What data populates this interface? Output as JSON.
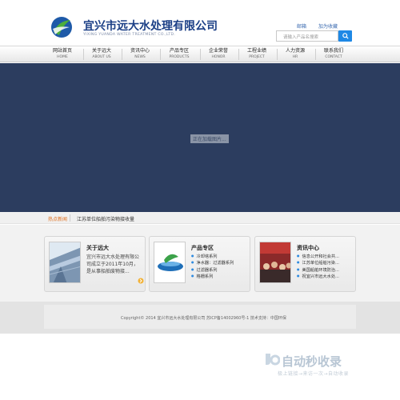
{
  "header": {
    "company_name": "宜兴市远大水处理有限公司",
    "company_name_en": "YIXING YUANDA WATER TREATMENT CO.,LTD.",
    "top_links": [
      "邮箱",
      "加为收藏"
    ],
    "search": {
      "placeholder": "请输入产品名搜索"
    }
  },
  "nav": [
    {
      "cn": "网站首页",
      "en": "HOME"
    },
    {
      "cn": "关于远大",
      "en": "ABOUT US"
    },
    {
      "cn": "资讯中心",
      "en": "NEWS"
    },
    {
      "cn": "产品专区",
      "en": "PRODUCTS"
    },
    {
      "cn": "企业荣誉",
      "en": "HONOR"
    },
    {
      "cn": "工程业绩",
      "en": "PROJECT"
    },
    {
      "cn": "人力资源",
      "en": "HR"
    },
    {
      "cn": "联系我们",
      "en": "CONTACT"
    }
  ],
  "banner": {
    "status_text": "正在加载图片..."
  },
  "ticker": {
    "label": "热点新闻",
    "headline": "江苏单位船舶污染物接收量"
  },
  "cards": {
    "about": {
      "title": "关于远大",
      "body": "宜兴市远大水处理有限公司成立于2011年10月，是从事船舶废物接..."
    },
    "products": {
      "title": "产品专区",
      "items": [
        "冷却塔系列",
        "净水器：过滤器系列",
        "过滤器系列",
        "格栅系列"
      ]
    },
    "news": {
      "title": "资讯中心",
      "items": [
        "信息公开和社会共...",
        "江苏单位船舶污染...",
        "美国船舶环境防治...",
        "祝宜兴市远大水处..."
      ]
    }
  },
  "footer": {
    "copyright": "Copyright© 2014  宜兴市远大水处理有限公司  苏ICP备14002960号-1        技术支持：中国环保"
  },
  "watermark": {
    "title": "自动秒收录",
    "subtitle": "极上链接→来访一次→自动收录"
  },
  "colors": {
    "brand": "#1b3f86",
    "banner": "#2c3d5f",
    "accent": "#1e88e5",
    "ticker_label": "#e06d1a"
  }
}
